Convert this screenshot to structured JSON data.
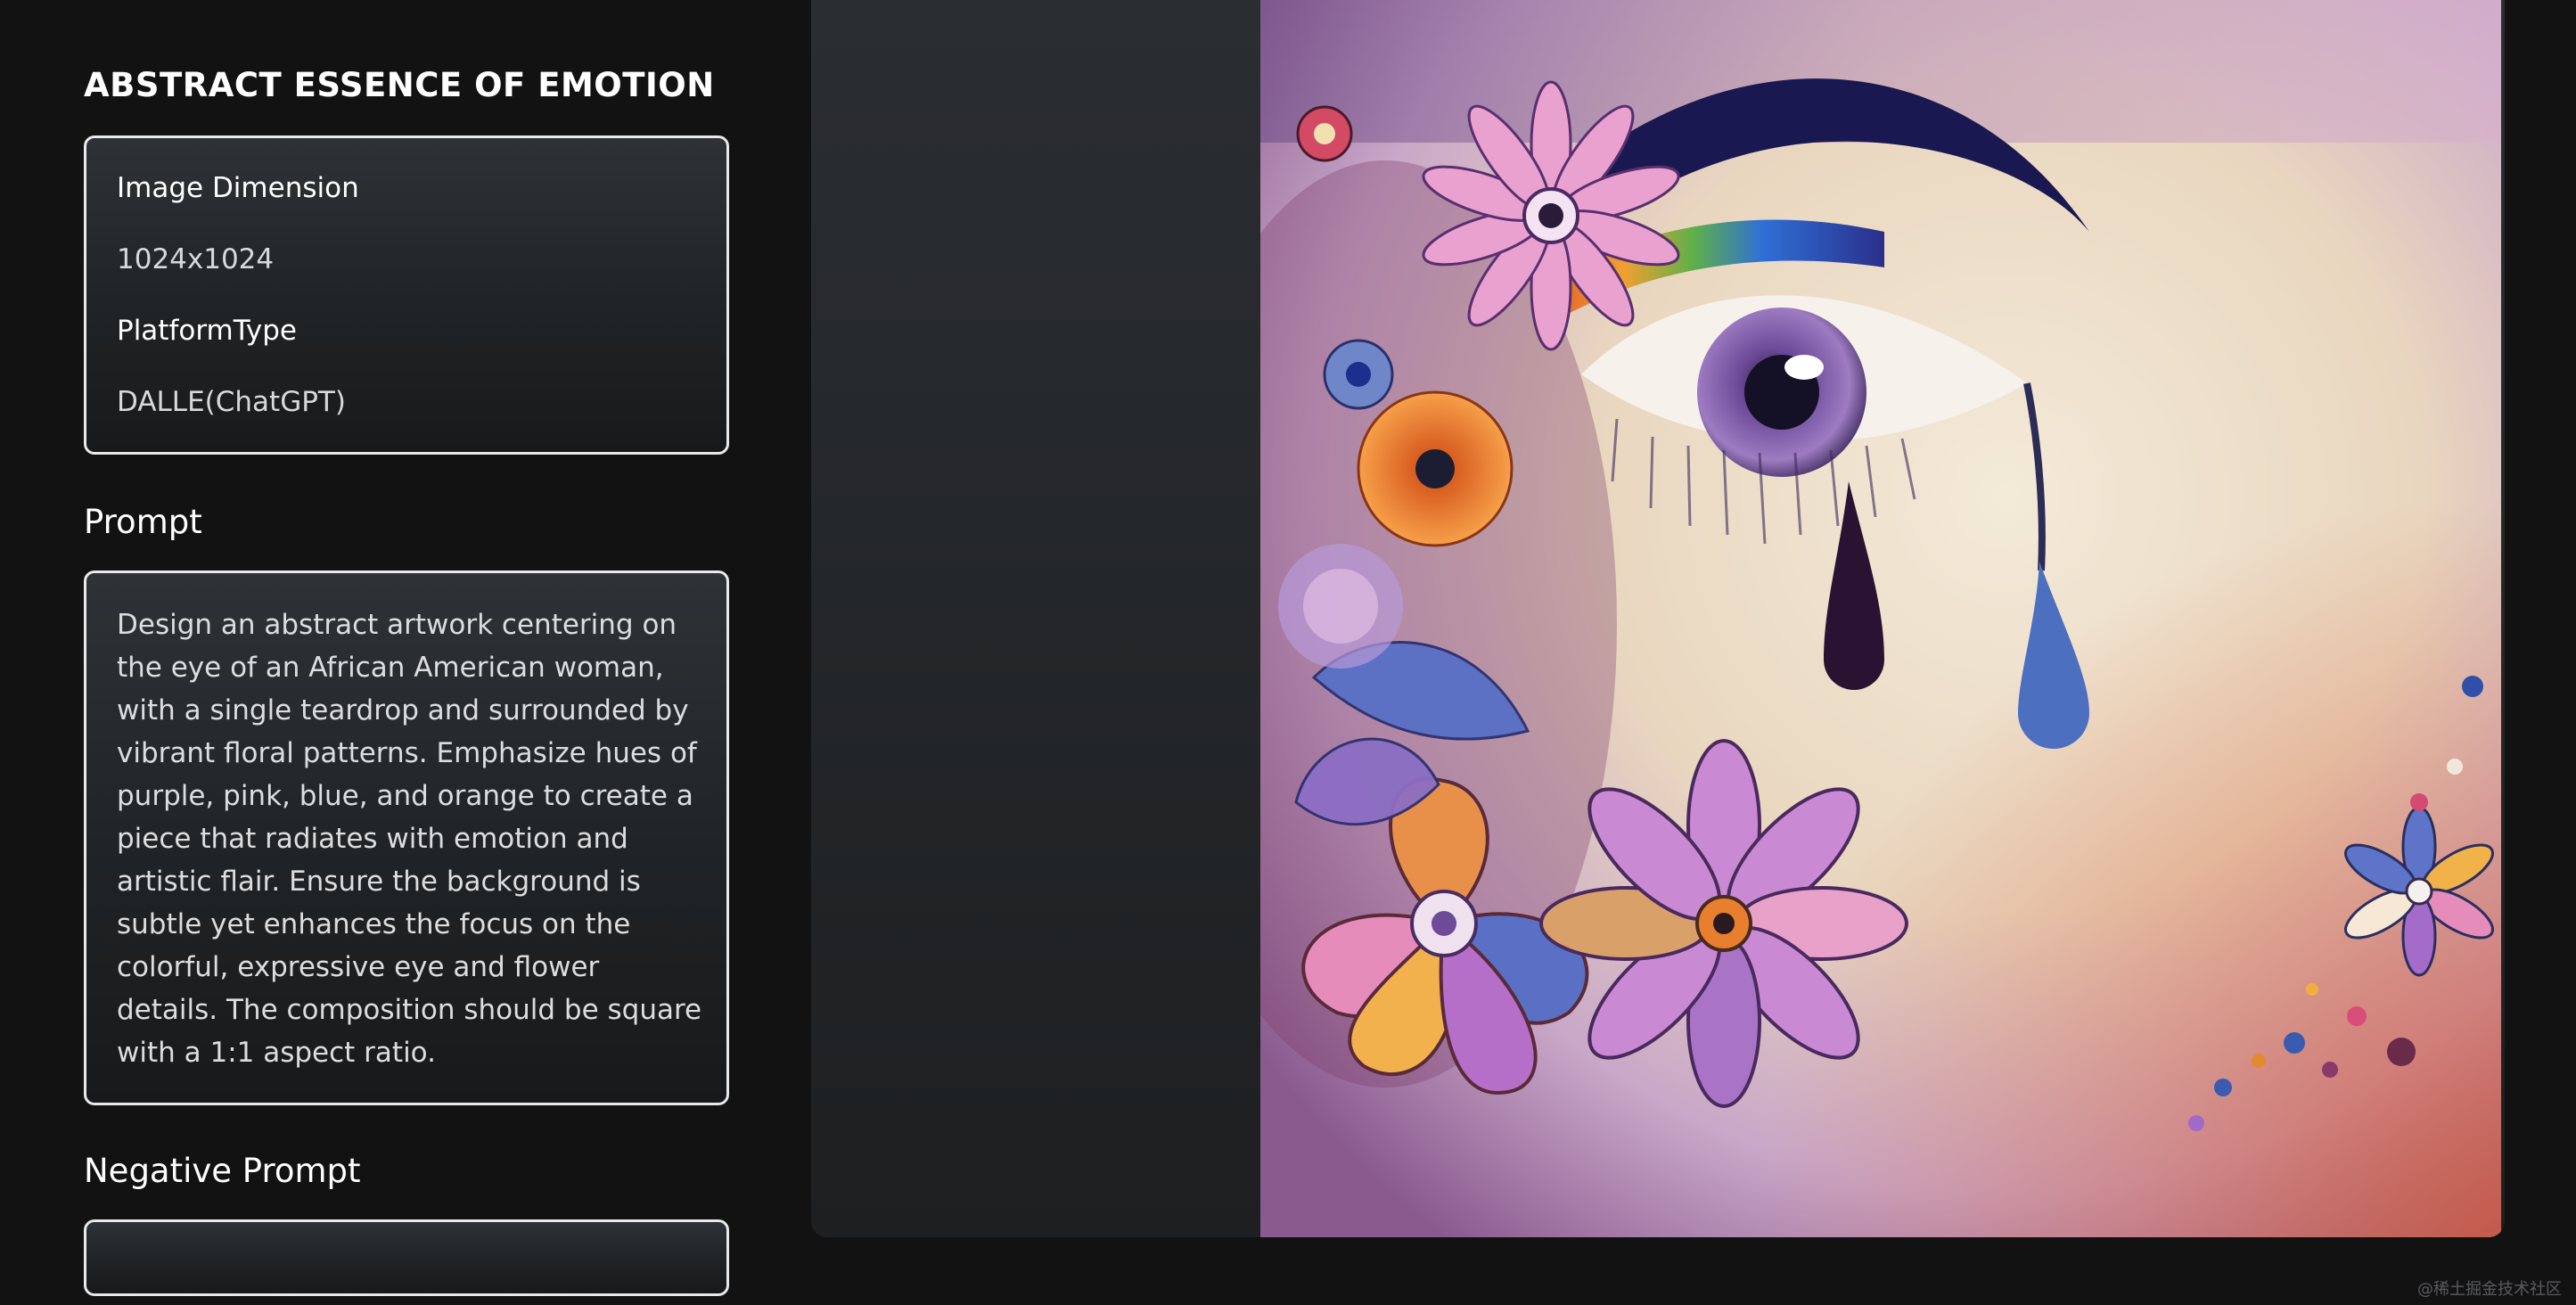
{
  "details": {
    "title": "ABSTRACT ESSENCE OF EMOTION",
    "image_dimension_label": "Image Dimension",
    "image_dimension_value": "1024x1024",
    "platform_label": "PlatformType",
    "platform_value": "DALLE(ChatGPT)",
    "prompt_heading": "Prompt",
    "prompt_text": "Design an abstract artwork centering on the eye of an African American woman, with a single teardrop and surrounded by vibrant floral patterns. Emphasize hues of purple, pink, blue, and orange to create a piece that radiates with emotion and artistic flair. Ensure the background is subtle yet enhances the focus on the colorful, expressive eye and flower details. The composition should be square with a 1:1 aspect ratio.",
    "negative_prompt_heading": "Negative Prompt",
    "negative_prompt_text": ""
  },
  "watermark": "@稀土掘金技术社区"
}
